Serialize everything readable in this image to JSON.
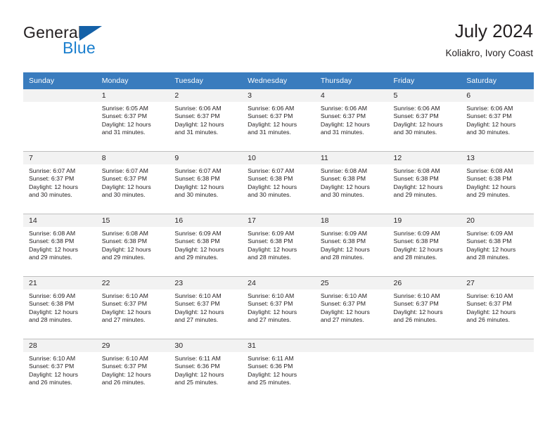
{
  "brand": {
    "name_part1": "General",
    "name_part2": "Blue",
    "triangle_color": "#1461a8",
    "blue_text_color": "#1b7fce"
  },
  "header": {
    "title": "July 2024",
    "subtitle": "Koliakro, Ivory Coast"
  },
  "colors": {
    "header_row_bg": "#3a7cbe",
    "header_row_text": "#ffffff",
    "daynum_band_bg": "#f2f2f2",
    "grid_line": "#bfbfbf",
    "body_text": "#231f20"
  },
  "weekday_headers": [
    "Sunday",
    "Monday",
    "Tuesday",
    "Wednesday",
    "Thursday",
    "Friday",
    "Saturday"
  ],
  "labels": {
    "sunrise_prefix": "Sunrise: ",
    "sunset_prefix": "Sunset: ",
    "daylight_prefix": "Daylight: "
  },
  "weeks": [
    [
      {
        "day": "",
        "sunrise": "",
        "sunset": "",
        "daylight_line1": "",
        "daylight_line2": ""
      },
      {
        "day": "1",
        "sunrise": "Sunrise: 6:05 AM",
        "sunset": "Sunset: 6:37 PM",
        "daylight_line1": "Daylight: 12 hours",
        "daylight_line2": "and 31 minutes."
      },
      {
        "day": "2",
        "sunrise": "Sunrise: 6:06 AM",
        "sunset": "Sunset: 6:37 PM",
        "daylight_line1": "Daylight: 12 hours",
        "daylight_line2": "and 31 minutes."
      },
      {
        "day": "3",
        "sunrise": "Sunrise: 6:06 AM",
        "sunset": "Sunset: 6:37 PM",
        "daylight_line1": "Daylight: 12 hours",
        "daylight_line2": "and 31 minutes."
      },
      {
        "day": "4",
        "sunrise": "Sunrise: 6:06 AM",
        "sunset": "Sunset: 6:37 PM",
        "daylight_line1": "Daylight: 12 hours",
        "daylight_line2": "and 31 minutes."
      },
      {
        "day": "5",
        "sunrise": "Sunrise: 6:06 AM",
        "sunset": "Sunset: 6:37 PM",
        "daylight_line1": "Daylight: 12 hours",
        "daylight_line2": "and 30 minutes."
      },
      {
        "day": "6",
        "sunrise": "Sunrise: 6:06 AM",
        "sunset": "Sunset: 6:37 PM",
        "daylight_line1": "Daylight: 12 hours",
        "daylight_line2": "and 30 minutes."
      }
    ],
    [
      {
        "day": "7",
        "sunrise": "Sunrise: 6:07 AM",
        "sunset": "Sunset: 6:37 PM",
        "daylight_line1": "Daylight: 12 hours",
        "daylight_line2": "and 30 minutes."
      },
      {
        "day": "8",
        "sunrise": "Sunrise: 6:07 AM",
        "sunset": "Sunset: 6:37 PM",
        "daylight_line1": "Daylight: 12 hours",
        "daylight_line2": "and 30 minutes."
      },
      {
        "day": "9",
        "sunrise": "Sunrise: 6:07 AM",
        "sunset": "Sunset: 6:38 PM",
        "daylight_line1": "Daylight: 12 hours",
        "daylight_line2": "and 30 minutes."
      },
      {
        "day": "10",
        "sunrise": "Sunrise: 6:07 AM",
        "sunset": "Sunset: 6:38 PM",
        "daylight_line1": "Daylight: 12 hours",
        "daylight_line2": "and 30 minutes."
      },
      {
        "day": "11",
        "sunrise": "Sunrise: 6:08 AM",
        "sunset": "Sunset: 6:38 PM",
        "daylight_line1": "Daylight: 12 hours",
        "daylight_line2": "and 30 minutes."
      },
      {
        "day": "12",
        "sunrise": "Sunrise: 6:08 AM",
        "sunset": "Sunset: 6:38 PM",
        "daylight_line1": "Daylight: 12 hours",
        "daylight_line2": "and 29 minutes."
      },
      {
        "day": "13",
        "sunrise": "Sunrise: 6:08 AM",
        "sunset": "Sunset: 6:38 PM",
        "daylight_line1": "Daylight: 12 hours",
        "daylight_line2": "and 29 minutes."
      }
    ],
    [
      {
        "day": "14",
        "sunrise": "Sunrise: 6:08 AM",
        "sunset": "Sunset: 6:38 PM",
        "daylight_line1": "Daylight: 12 hours",
        "daylight_line2": "and 29 minutes."
      },
      {
        "day": "15",
        "sunrise": "Sunrise: 6:08 AM",
        "sunset": "Sunset: 6:38 PM",
        "daylight_line1": "Daylight: 12 hours",
        "daylight_line2": "and 29 minutes."
      },
      {
        "day": "16",
        "sunrise": "Sunrise: 6:09 AM",
        "sunset": "Sunset: 6:38 PM",
        "daylight_line1": "Daylight: 12 hours",
        "daylight_line2": "and 29 minutes."
      },
      {
        "day": "17",
        "sunrise": "Sunrise: 6:09 AM",
        "sunset": "Sunset: 6:38 PM",
        "daylight_line1": "Daylight: 12 hours",
        "daylight_line2": "and 28 minutes."
      },
      {
        "day": "18",
        "sunrise": "Sunrise: 6:09 AM",
        "sunset": "Sunset: 6:38 PM",
        "daylight_line1": "Daylight: 12 hours",
        "daylight_line2": "and 28 minutes."
      },
      {
        "day": "19",
        "sunrise": "Sunrise: 6:09 AM",
        "sunset": "Sunset: 6:38 PM",
        "daylight_line1": "Daylight: 12 hours",
        "daylight_line2": "and 28 minutes."
      },
      {
        "day": "20",
        "sunrise": "Sunrise: 6:09 AM",
        "sunset": "Sunset: 6:38 PM",
        "daylight_line1": "Daylight: 12 hours",
        "daylight_line2": "and 28 minutes."
      }
    ],
    [
      {
        "day": "21",
        "sunrise": "Sunrise: 6:09 AM",
        "sunset": "Sunset: 6:38 PM",
        "daylight_line1": "Daylight: 12 hours",
        "daylight_line2": "and 28 minutes."
      },
      {
        "day": "22",
        "sunrise": "Sunrise: 6:10 AM",
        "sunset": "Sunset: 6:37 PM",
        "daylight_line1": "Daylight: 12 hours",
        "daylight_line2": "and 27 minutes."
      },
      {
        "day": "23",
        "sunrise": "Sunrise: 6:10 AM",
        "sunset": "Sunset: 6:37 PM",
        "daylight_line1": "Daylight: 12 hours",
        "daylight_line2": "and 27 minutes."
      },
      {
        "day": "24",
        "sunrise": "Sunrise: 6:10 AM",
        "sunset": "Sunset: 6:37 PM",
        "daylight_line1": "Daylight: 12 hours",
        "daylight_line2": "and 27 minutes."
      },
      {
        "day": "25",
        "sunrise": "Sunrise: 6:10 AM",
        "sunset": "Sunset: 6:37 PM",
        "daylight_line1": "Daylight: 12 hours",
        "daylight_line2": "and 27 minutes."
      },
      {
        "day": "26",
        "sunrise": "Sunrise: 6:10 AM",
        "sunset": "Sunset: 6:37 PM",
        "daylight_line1": "Daylight: 12 hours",
        "daylight_line2": "and 26 minutes."
      },
      {
        "day": "27",
        "sunrise": "Sunrise: 6:10 AM",
        "sunset": "Sunset: 6:37 PM",
        "daylight_line1": "Daylight: 12 hours",
        "daylight_line2": "and 26 minutes."
      }
    ],
    [
      {
        "day": "28",
        "sunrise": "Sunrise: 6:10 AM",
        "sunset": "Sunset: 6:37 PM",
        "daylight_line1": "Daylight: 12 hours",
        "daylight_line2": "and 26 minutes."
      },
      {
        "day": "29",
        "sunrise": "Sunrise: 6:10 AM",
        "sunset": "Sunset: 6:37 PM",
        "daylight_line1": "Daylight: 12 hours",
        "daylight_line2": "and 26 minutes."
      },
      {
        "day": "30",
        "sunrise": "Sunrise: 6:11 AM",
        "sunset": "Sunset: 6:36 PM",
        "daylight_line1": "Daylight: 12 hours",
        "daylight_line2": "and 25 minutes."
      },
      {
        "day": "31",
        "sunrise": "Sunrise: 6:11 AM",
        "sunset": "Sunset: 6:36 PM",
        "daylight_line1": "Daylight: 12 hours",
        "daylight_line2": "and 25 minutes."
      },
      {
        "day": "",
        "sunrise": "",
        "sunset": "",
        "daylight_line1": "",
        "daylight_line2": ""
      },
      {
        "day": "",
        "sunrise": "",
        "sunset": "",
        "daylight_line1": "",
        "daylight_line2": ""
      },
      {
        "day": "",
        "sunrise": "",
        "sunset": "",
        "daylight_line1": "",
        "daylight_line2": ""
      }
    ]
  ]
}
